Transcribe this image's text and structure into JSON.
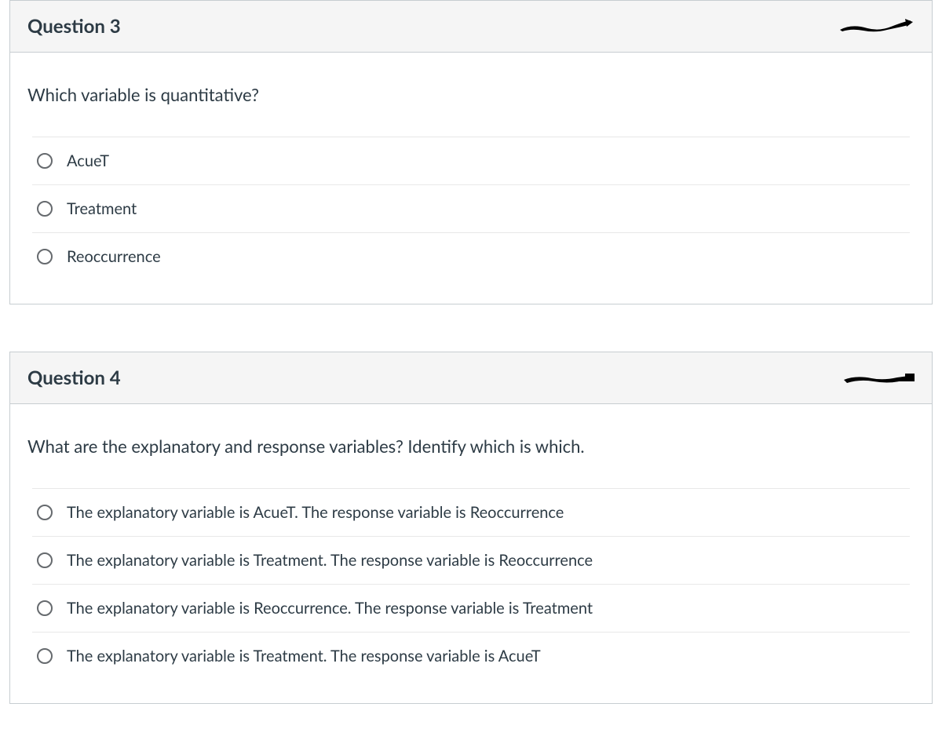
{
  "questions": [
    {
      "title": "Question 3",
      "prompt": "Which variable is quantitative?",
      "options": [
        "AcueT",
        "Treatment",
        "Reoccurrence"
      ]
    },
    {
      "title": "Question 4",
      "prompt": "What are the explanatory and response variables? Identify which is which.",
      "options": [
        "The explanatory variable is AcueT. The response variable is Reoccurrence",
        "The explanatory variable is Treatment. The response variable is Reoccurrence",
        "The explanatory variable is Reoccurrence. The response variable is Treatment",
        "The explanatory variable is Treatment. The response variable is AcueT"
      ]
    }
  ]
}
